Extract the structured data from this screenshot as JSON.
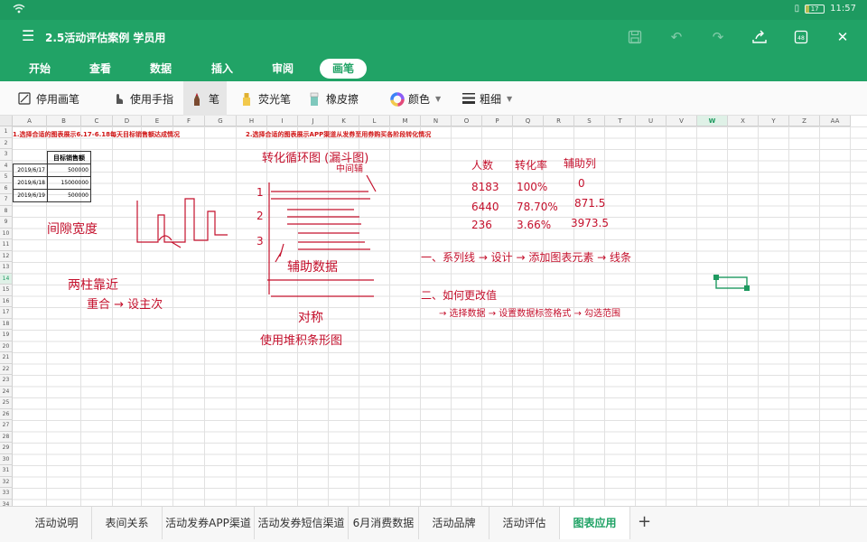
{
  "status": {
    "time": "11:57",
    "battery": "17"
  },
  "title": {
    "menu_icon": "menu-icon",
    "doc_title": "2.5活动评估案例 学员用"
  },
  "ribbon_tabs": [
    {
      "label": "开始"
    },
    {
      "label": "查看"
    },
    {
      "label": "数据"
    },
    {
      "label": "插入"
    },
    {
      "label": "审阅"
    },
    {
      "label": "画笔",
      "active": true
    }
  ],
  "tools": {
    "stop_pen": "停用画笔",
    "use_finger": "使用手指",
    "pen": "笔",
    "highlighter": "荧光笔",
    "eraser": "橡皮擦",
    "color": "颜色",
    "thickness": "粗细"
  },
  "columns": [
    "A",
    "B",
    "C",
    "D",
    "E",
    "F",
    "G",
    "H",
    "I",
    "J",
    "K",
    "L",
    "M",
    "N",
    "O",
    "P",
    "Q",
    "R",
    "S",
    "T",
    "U",
    "V",
    "W",
    "X",
    "Y",
    "Z",
    "AA"
  ],
  "active_column": "W",
  "active_row": "14",
  "rows": [
    "1",
    "2",
    "3",
    "4",
    "5",
    "6",
    "7",
    "8",
    "9",
    "10",
    "11",
    "12",
    "13",
    "14",
    "15",
    "16",
    "17",
    "18",
    "19",
    "20",
    "21",
    "22",
    "23",
    "24",
    "25",
    "26",
    "27",
    "28",
    "29",
    "30",
    "31",
    "32",
    "33",
    "34"
  ],
  "cells": {
    "a1_text": "1.选择合适的图表展示6.17-6.18每天目标销售额达成情况",
    "h1_text": "2.选择合适的图表展示APP渠道从发券至用券购买各阶段转化情况",
    "table_header": "目标销售额",
    "table_rows": [
      {
        "date": "2019/6/17",
        "value": "500000"
      },
      {
        "date": "2019/6/18",
        "value": "15000000"
      },
      {
        "date": "2019/6/19",
        "value": "500000"
      }
    ]
  },
  "handwriting": {
    "left_1": "间隙宽度",
    "left_2": "两柱靠近",
    "left_3": "重合 → 设主次",
    "mid_title": "转化循环图 (漏斗图)",
    "mid_top": "中间辅",
    "mid_nums": [
      "1",
      "2",
      "3"
    ],
    "mid_aux": "辅助数据",
    "mid_cross": "对称",
    "mid_bottom": "使用堆积条形图",
    "right_headers": [
      "人数",
      "转化率",
      "辅助列"
    ],
    "right_rows": [
      [
        "8183",
        "100%",
        "0"
      ],
      [
        "6440",
        "78.70%",
        "871.5"
      ],
      [
        "236",
        "3.66%",
        "3973.5"
      ]
    ],
    "step_1": "一、系列线 → 设计 → 添加图表元素 → 线条",
    "step_2": "二、如何更改值",
    "step_3": "→ 选择数据 → 设置数据标签格式 → 勾选范围"
  },
  "sheet_tabs": [
    {
      "label": "活动说明"
    },
    {
      "label": "表间关系"
    },
    {
      "label": "活动发券APP渠道"
    },
    {
      "label": "活动发券短信渠道"
    },
    {
      "label": "6月消费数据"
    },
    {
      "label": "活动品牌"
    },
    {
      "label": "活动评估"
    },
    {
      "label": "图表应用",
      "active": true
    }
  ],
  "add_sheet": "+",
  "colors": {
    "brand": "#21a366",
    "ink": "#c4102c",
    "selection": "#1e9a60"
  }
}
